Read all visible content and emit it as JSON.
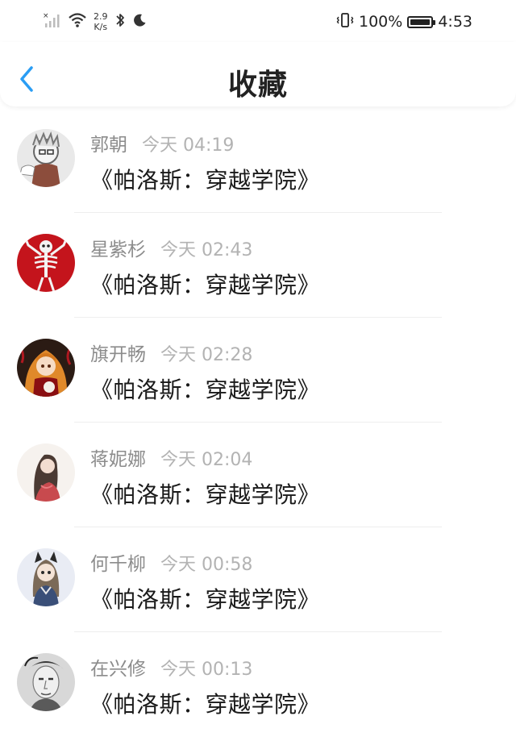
{
  "status_bar": {
    "speed_value": "2.9",
    "speed_unit": "K/s",
    "battery": "100%",
    "battery_level": 1.0,
    "time": "4:53"
  },
  "header": {
    "title": "收藏"
  },
  "items": [
    {
      "user": "郭朝",
      "time": "今天 04:19",
      "title": "《帕洛斯：穿越学院》"
    },
    {
      "user": "星紫杉",
      "time": "今天 02:43",
      "title": "《帕洛斯：穿越学院》"
    },
    {
      "user": "旗开畅",
      "time": "今天 02:28",
      "title": "《帕洛斯：穿越学院》"
    },
    {
      "user": "蒋妮娜",
      "time": "今天 02:04",
      "title": "《帕洛斯：穿越学院》"
    },
    {
      "user": "何千柳",
      "time": "今天 00:58",
      "title": "《帕洛斯：穿越学院》"
    },
    {
      "user": "在兴修",
      "time": "今天 00:13",
      "title": "《帕洛斯：穿越学院》"
    }
  ],
  "colors": {
    "accent_back": "#2a9df4",
    "title_text": "#222222",
    "name_text": "#8c8c8c",
    "time_text": "#b3b3b3"
  }
}
